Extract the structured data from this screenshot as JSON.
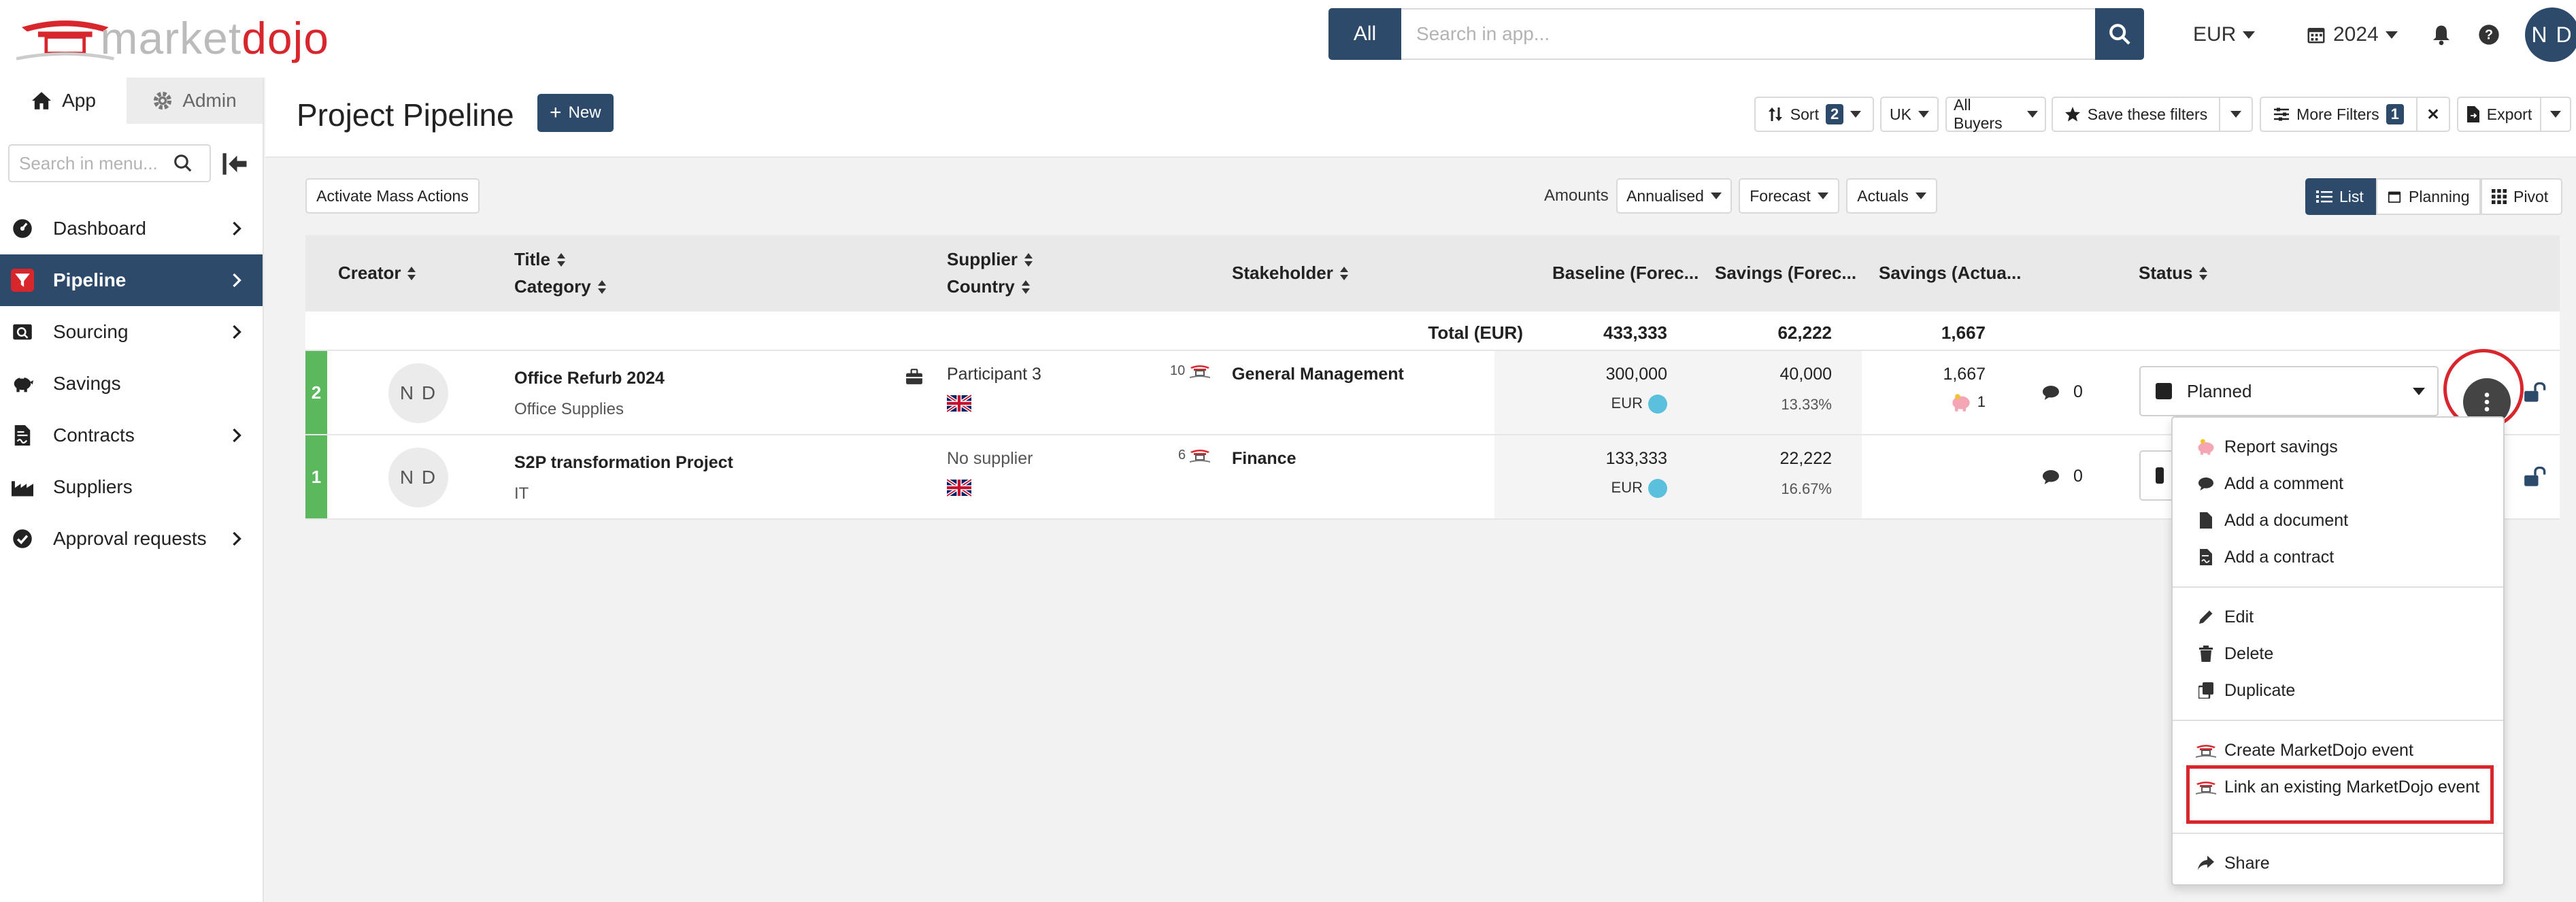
{
  "brand": {
    "logo_part1": "market",
    "logo_part2": "dojo"
  },
  "search": {
    "scope_label": "All",
    "placeholder": "Search in app..."
  },
  "topbar": {
    "currency": "EUR",
    "year": "2024",
    "user_initials": "N D"
  },
  "sidebar": {
    "tabs": [
      {
        "label": "App"
      },
      {
        "label": "Admin"
      }
    ],
    "search_placeholder": "Search in menu...",
    "items": [
      {
        "label": "Dashboard",
        "has_children": true
      },
      {
        "label": "Pipeline",
        "has_children": true,
        "active": true
      },
      {
        "label": "Sourcing",
        "has_children": true
      },
      {
        "label": "Savings",
        "has_children": false
      },
      {
        "label": "Contracts",
        "has_children": true
      },
      {
        "label": "Suppliers",
        "has_children": false
      },
      {
        "label": "Approval requests",
        "has_children": true
      }
    ]
  },
  "header": {
    "title": "Project Pipeline",
    "new_label": "New",
    "sort_label": "Sort",
    "sort_count": "2",
    "region": "UK",
    "buyers": "All Buyers",
    "save_filters": "Save these filters",
    "more_filters": "More Filters",
    "more_filters_count": "1",
    "clear": "✕",
    "export": "Export"
  },
  "toolbar": {
    "mass_actions": "Activate Mass Actions",
    "amounts_label": "Amounts",
    "amounts_mode": "Annualised",
    "forecast": "Forecast",
    "actuals": "Actuals",
    "views": [
      "List",
      "Planning",
      "Pivot"
    ]
  },
  "table": {
    "columns": {
      "creator": "Creator",
      "title": "Title",
      "category": "Category",
      "supplier": "Supplier",
      "country": "Country",
      "stakeholder": "Stakeholder",
      "baseline": "Baseline (Forec...",
      "savings_forecast": "Savings (Forec...",
      "savings_actual": "Savings (Actua...",
      "status": "Status"
    },
    "total": {
      "label": "Total (EUR)",
      "baseline": "433,333",
      "savings_forecast": "62,222",
      "savings_actual": "1,667"
    },
    "rows": [
      {
        "num": "2",
        "creator": "N D",
        "title": "Office Refurb 2024",
        "category": "Office Supplies",
        "supplier": "Participant 3",
        "dojo_count": "10",
        "stakeholder": "General Management",
        "baseline": "300,000",
        "currency": "EUR",
        "savings_forecast": "40,000",
        "savings_pct": "13.33%",
        "savings_actual": "1,667",
        "savings_actual_count": "1",
        "comments": "0",
        "status": "Planned"
      },
      {
        "num": "1",
        "creator": "N D",
        "title": "S2P transformation Project",
        "category": "IT",
        "supplier": "No supplier",
        "dojo_count": "6",
        "stakeholder": "Finance",
        "baseline": "133,333",
        "currency": "EUR",
        "savings_forecast": "22,222",
        "savings_pct": "16.67%",
        "comments": "0"
      }
    ]
  },
  "menu": {
    "items": [
      "Report savings",
      "Add a comment",
      "Add a document",
      "Add a contract",
      "Edit",
      "Delete",
      "Duplicate",
      "Create MarketDojo event",
      "Link an existing MarketDojo event",
      "Share"
    ]
  },
  "colors": {
    "navy": "#2e4a6b",
    "red": "#d8262d",
    "green": "#5cb85c",
    "blue_dot": "#5bc0de"
  }
}
